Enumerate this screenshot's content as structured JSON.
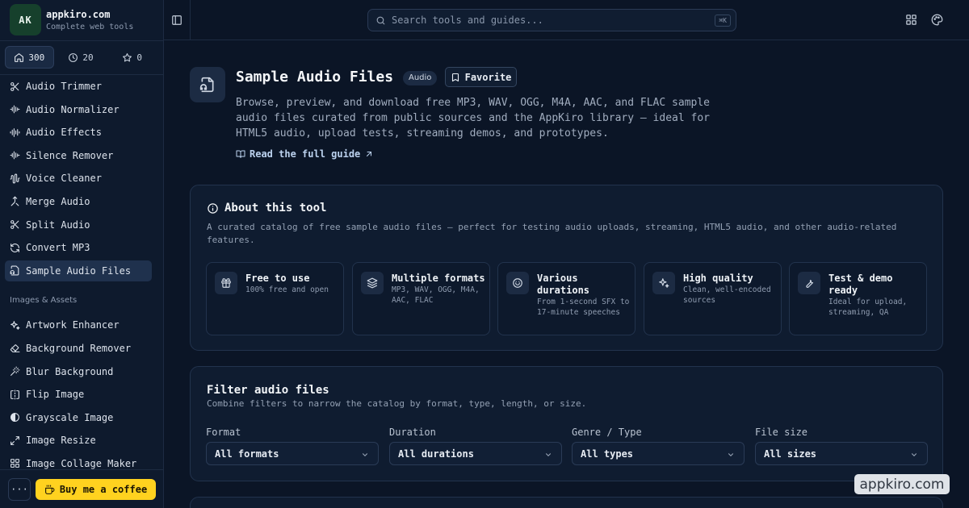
{
  "brand": {
    "logo_text": "AK",
    "name": "appkiro.com",
    "tagline": "Complete web tools"
  },
  "stats": [
    {
      "icon": "home-icon",
      "value": "300",
      "active": true
    },
    {
      "icon": "clock-icon",
      "value": "20",
      "active": false
    },
    {
      "icon": "star-icon",
      "value": "0",
      "active": false
    }
  ],
  "sidebar": {
    "audio_items": [
      {
        "label": "Audio Trimmer",
        "icon": "scissors-icon"
      },
      {
        "label": "Audio Normalizer",
        "icon": "waveform-icon"
      },
      {
        "label": "Audio Effects",
        "icon": "audio-lines-icon"
      },
      {
        "label": "Silence Remover",
        "icon": "waveform-icon"
      },
      {
        "label": "Voice Cleaner",
        "icon": "audio-waveform-icon"
      },
      {
        "label": "Merge Audio",
        "icon": "merge-icon"
      },
      {
        "label": "Split Audio",
        "icon": "scissors-icon"
      },
      {
        "label": "Convert MP3",
        "icon": "refresh-icon"
      },
      {
        "label": "Sample Audio Files",
        "icon": "headphones-file-icon",
        "active": true
      }
    ],
    "section_images": "Images & Assets",
    "image_items": [
      {
        "label": "Artwork Enhancer",
        "icon": "sparkles-icon"
      },
      {
        "label": "Background Remover",
        "icon": "eraser-icon"
      },
      {
        "label": "Blur Background",
        "icon": "wand-icon"
      },
      {
        "label": "Flip Image",
        "icon": "flip-icon"
      },
      {
        "label": "Grayscale Image",
        "icon": "contrast-icon"
      },
      {
        "label": "Image Resize",
        "icon": "resize-icon"
      },
      {
        "label": "Image Collage Maker",
        "icon": "grid-icon"
      }
    ],
    "more_label": "···",
    "coffee_label": "Buy me a coffee"
  },
  "search": {
    "placeholder": "Search tools and guides...",
    "shortcut": "⌘K"
  },
  "hero": {
    "title": "Sample Audio Files",
    "badge": "Audio",
    "favorite_label": "Favorite",
    "description": "Browse, preview, and download free MP3, WAV, OGG, M4A, AAC, and FLAC sample audio files curated from public sources and the AppKiro library — ideal for HTML5 audio, upload tests, streaming demos, and prototypes.",
    "guide_link": "Read the full guide"
  },
  "about": {
    "title": "About this tool",
    "description": "A curated catalog of free sample audio files — perfect for testing audio uploads, streaming, HTML5 audio, and other audio-related features.",
    "features": [
      {
        "icon": "gift-icon",
        "title": "Free to use",
        "desc": "100% free and open"
      },
      {
        "icon": "layers-icon",
        "title": "Multiple formats",
        "desc": "MP3, WAV, OGG, M4A, AAC, FLAC"
      },
      {
        "icon": "timer-icon",
        "title": "Various durations",
        "desc": "From 1-second SFX to 17-minute speeches"
      },
      {
        "icon": "sparkles-icon",
        "title": "High quality",
        "desc": "Clean, well-encoded sources"
      },
      {
        "icon": "wrench-icon",
        "title": "Test & demo ready",
        "desc": "Ideal for upload, streaming, QA"
      }
    ]
  },
  "filter": {
    "title": "Filter audio files",
    "description": "Combine filters to narrow the catalog by format, type, length, or size.",
    "fields": [
      {
        "label": "Format",
        "value": "All formats"
      },
      {
        "label": "Duration",
        "value": "All durations"
      },
      {
        "label": "Genre / Type",
        "value": "All types"
      },
      {
        "label": "File size",
        "value": "All sizes"
      }
    ]
  },
  "watermark": "appkiro.com"
}
